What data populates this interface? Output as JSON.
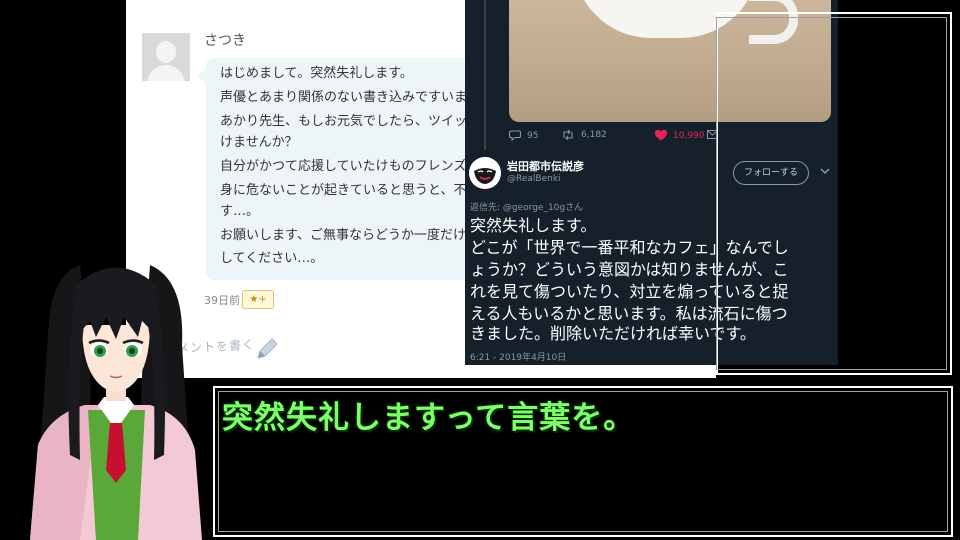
{
  "blog_comment": {
    "commenter_name": "さつき",
    "body_lines": [
      "はじめまして。突然失礼します。",
      "声優とあまり関係のない書き込みですいませ",
      "あかり先生、もしお元気でしたら、ツイッ",
      "けませんか？",
      "自分がかつて応援していたけものフレンズ",
      "身に危ないことが起きていると思うと、不",
      "す…。",
      "お願いします、ご無事ならどうか一度だけ",
      "してください…。"
    ],
    "posted_ago": "39日前",
    "star_button_label": "★+",
    "write_comment_label": "コメントを書く"
  },
  "tweet": {
    "reply_count": "95",
    "retweet_count": "6,182",
    "like_count": "10,990",
    "display_name": "岩田都市伝説彦",
    "handle": "@RealBenki",
    "follow_button_label": "フォローする",
    "replying_to": "返信先: @george_10gさん",
    "text_lines": [
      "突然失礼します。",
      "どこが「世界で一番平和なカフェ」なんでし",
      "ょうか？どういう意図かは知りませんが、こ",
      "れを見て傷ついたり、対立を煽っていると捉",
      "える人もいるかと思います。私は流石に傷つ",
      "きました。削除いただければ幸いです。"
    ],
    "timestamp": "6:21 - 2019年4月10日"
  },
  "dialog": {
    "subtitle": "突然失礼しますって言葉を。",
    "subtitle_color": "#7dff6a"
  },
  "colors": {
    "tweet_background": "#15202b",
    "like_color": "#e0245e",
    "frame_color": "#ffffff"
  }
}
